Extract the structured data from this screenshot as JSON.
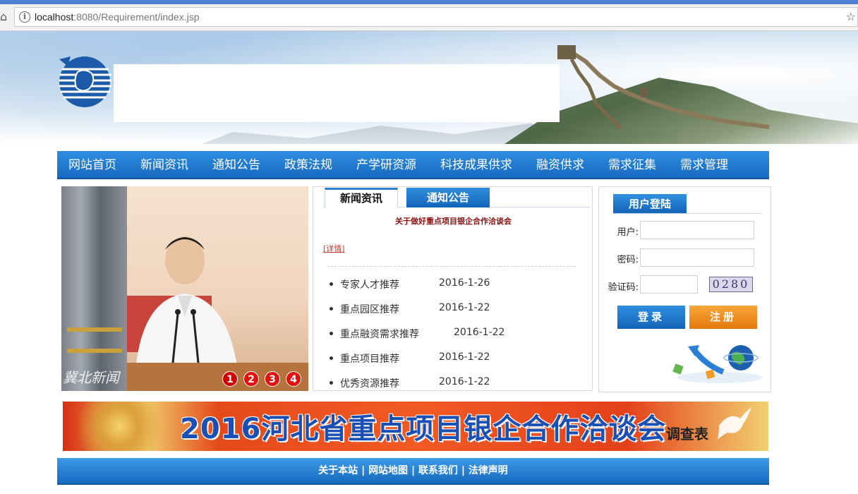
{
  "browser": {
    "url_host": "localhost",
    "url_rest": ":8080/Requirement/index.jsp"
  },
  "nav": {
    "items": [
      "网站首页",
      "新闻资讯",
      "通知公告",
      "政策法规",
      "产学研资源",
      "科技成果供求",
      "融资供求",
      "需求征集",
      "需求管理"
    ]
  },
  "slider": {
    "buttons": [
      "1",
      "2",
      "3",
      "4"
    ],
    "watermark": "冀北新闻"
  },
  "news": {
    "tabs": [
      "新闻资讯",
      "通知公告"
    ],
    "headline": "关于做好重点项目银企合作洽谈会",
    "detail_link": "[详情]",
    "items": [
      {
        "name": "专家人才推荐",
        "date": "2016-1-26"
      },
      {
        "name": "重点园区推荐",
        "date": "2016-1-22"
      },
      {
        "name": "重点融资需求推荐",
        "date": "2016-1-22"
      },
      {
        "name": "重点项目推荐",
        "date": "2016-1-22"
      },
      {
        "name": "优秀资源推荐",
        "date": "2016-1-22"
      }
    ]
  },
  "login": {
    "title": "用户登陆",
    "user_label": "用户:",
    "password_label": "密码:",
    "captcha_label": "验证码:",
    "captcha_value": "0280",
    "login_button": "登录",
    "register_button": "注册"
  },
  "promo": {
    "title": "2016河北省重点项目银企合作洽谈会",
    "survey": "调查表"
  },
  "footer": {
    "links": [
      "关于本站",
      "网站地图",
      "联系我们",
      "法律声明"
    ]
  },
  "colors": {
    "nav_blue": "#1769c0",
    "register_orange": "#e5790d",
    "headline_red": "#8b1010"
  }
}
